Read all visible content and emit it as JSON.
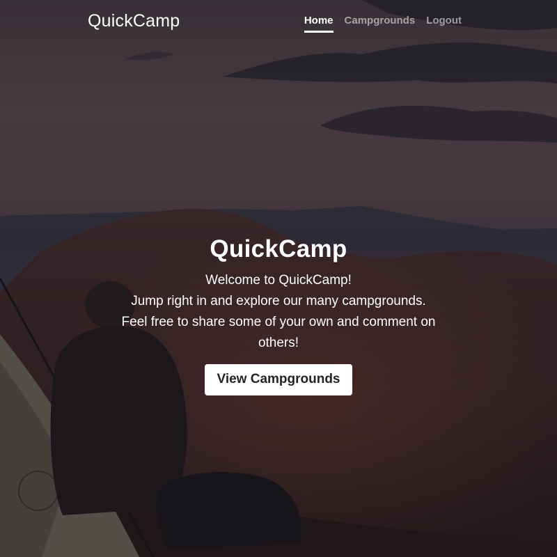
{
  "navbar": {
    "brand": "QuickCamp",
    "links": [
      {
        "label": "Home",
        "active": true
      },
      {
        "label": "Campgrounds",
        "active": false
      },
      {
        "label": "Logout",
        "active": false
      }
    ]
  },
  "hero": {
    "title": "QuickCamp",
    "lead_lines": [
      "Welcome to QuickCamp!",
      "Jump right in and explore our many campgrounds.",
      "Feel free to share some of your own and comment on others!"
    ],
    "button_label": "View Campgrounds"
  },
  "colors": {
    "overlay": "#000000",
    "text": "#ffffff",
    "button_bg": "#ffffff",
    "button_text": "#212529",
    "nav_inactive": "#a7a3a8"
  },
  "background": {
    "description_icon": "camper-sunset-photo"
  }
}
